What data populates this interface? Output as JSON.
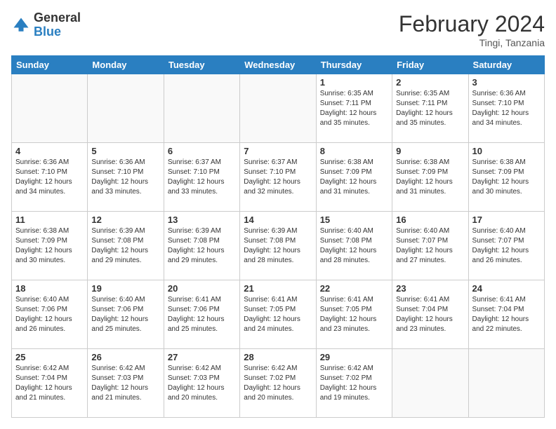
{
  "header": {
    "logo_general": "General",
    "logo_blue": "Blue",
    "month_title": "February 2024",
    "location": "Tingi, Tanzania"
  },
  "days_of_week": [
    "Sunday",
    "Monday",
    "Tuesday",
    "Wednesday",
    "Thursday",
    "Friday",
    "Saturday"
  ],
  "weeks": [
    [
      {
        "num": "",
        "info": ""
      },
      {
        "num": "",
        "info": ""
      },
      {
        "num": "",
        "info": ""
      },
      {
        "num": "",
        "info": ""
      },
      {
        "num": "1",
        "info": "Sunrise: 6:35 AM\nSunset: 7:11 PM\nDaylight: 12 hours\nand 35 minutes."
      },
      {
        "num": "2",
        "info": "Sunrise: 6:35 AM\nSunset: 7:11 PM\nDaylight: 12 hours\nand 35 minutes."
      },
      {
        "num": "3",
        "info": "Sunrise: 6:36 AM\nSunset: 7:10 PM\nDaylight: 12 hours\nand 34 minutes."
      }
    ],
    [
      {
        "num": "4",
        "info": "Sunrise: 6:36 AM\nSunset: 7:10 PM\nDaylight: 12 hours\nand 34 minutes."
      },
      {
        "num": "5",
        "info": "Sunrise: 6:36 AM\nSunset: 7:10 PM\nDaylight: 12 hours\nand 33 minutes."
      },
      {
        "num": "6",
        "info": "Sunrise: 6:37 AM\nSunset: 7:10 PM\nDaylight: 12 hours\nand 33 minutes."
      },
      {
        "num": "7",
        "info": "Sunrise: 6:37 AM\nSunset: 7:10 PM\nDaylight: 12 hours\nand 32 minutes."
      },
      {
        "num": "8",
        "info": "Sunrise: 6:38 AM\nSunset: 7:09 PM\nDaylight: 12 hours\nand 31 minutes."
      },
      {
        "num": "9",
        "info": "Sunrise: 6:38 AM\nSunset: 7:09 PM\nDaylight: 12 hours\nand 31 minutes."
      },
      {
        "num": "10",
        "info": "Sunrise: 6:38 AM\nSunset: 7:09 PM\nDaylight: 12 hours\nand 30 minutes."
      }
    ],
    [
      {
        "num": "11",
        "info": "Sunrise: 6:38 AM\nSunset: 7:09 PM\nDaylight: 12 hours\nand 30 minutes."
      },
      {
        "num": "12",
        "info": "Sunrise: 6:39 AM\nSunset: 7:08 PM\nDaylight: 12 hours\nand 29 minutes."
      },
      {
        "num": "13",
        "info": "Sunrise: 6:39 AM\nSunset: 7:08 PM\nDaylight: 12 hours\nand 29 minutes."
      },
      {
        "num": "14",
        "info": "Sunrise: 6:39 AM\nSunset: 7:08 PM\nDaylight: 12 hours\nand 28 minutes."
      },
      {
        "num": "15",
        "info": "Sunrise: 6:40 AM\nSunset: 7:08 PM\nDaylight: 12 hours\nand 28 minutes."
      },
      {
        "num": "16",
        "info": "Sunrise: 6:40 AM\nSunset: 7:07 PM\nDaylight: 12 hours\nand 27 minutes."
      },
      {
        "num": "17",
        "info": "Sunrise: 6:40 AM\nSunset: 7:07 PM\nDaylight: 12 hours\nand 26 minutes."
      }
    ],
    [
      {
        "num": "18",
        "info": "Sunrise: 6:40 AM\nSunset: 7:06 PM\nDaylight: 12 hours\nand 26 minutes."
      },
      {
        "num": "19",
        "info": "Sunrise: 6:40 AM\nSunset: 7:06 PM\nDaylight: 12 hours\nand 25 minutes."
      },
      {
        "num": "20",
        "info": "Sunrise: 6:41 AM\nSunset: 7:06 PM\nDaylight: 12 hours\nand 25 minutes."
      },
      {
        "num": "21",
        "info": "Sunrise: 6:41 AM\nSunset: 7:05 PM\nDaylight: 12 hours\nand 24 minutes."
      },
      {
        "num": "22",
        "info": "Sunrise: 6:41 AM\nSunset: 7:05 PM\nDaylight: 12 hours\nand 23 minutes."
      },
      {
        "num": "23",
        "info": "Sunrise: 6:41 AM\nSunset: 7:04 PM\nDaylight: 12 hours\nand 23 minutes."
      },
      {
        "num": "24",
        "info": "Sunrise: 6:41 AM\nSunset: 7:04 PM\nDaylight: 12 hours\nand 22 minutes."
      }
    ],
    [
      {
        "num": "25",
        "info": "Sunrise: 6:42 AM\nSunset: 7:04 PM\nDaylight: 12 hours\nand 21 minutes."
      },
      {
        "num": "26",
        "info": "Sunrise: 6:42 AM\nSunset: 7:03 PM\nDaylight: 12 hours\nand 21 minutes."
      },
      {
        "num": "27",
        "info": "Sunrise: 6:42 AM\nSunset: 7:03 PM\nDaylight: 12 hours\nand 20 minutes."
      },
      {
        "num": "28",
        "info": "Sunrise: 6:42 AM\nSunset: 7:02 PM\nDaylight: 12 hours\nand 20 minutes."
      },
      {
        "num": "29",
        "info": "Sunrise: 6:42 AM\nSunset: 7:02 PM\nDaylight: 12 hours\nand 19 minutes."
      },
      {
        "num": "",
        "info": ""
      },
      {
        "num": "",
        "info": ""
      }
    ]
  ]
}
